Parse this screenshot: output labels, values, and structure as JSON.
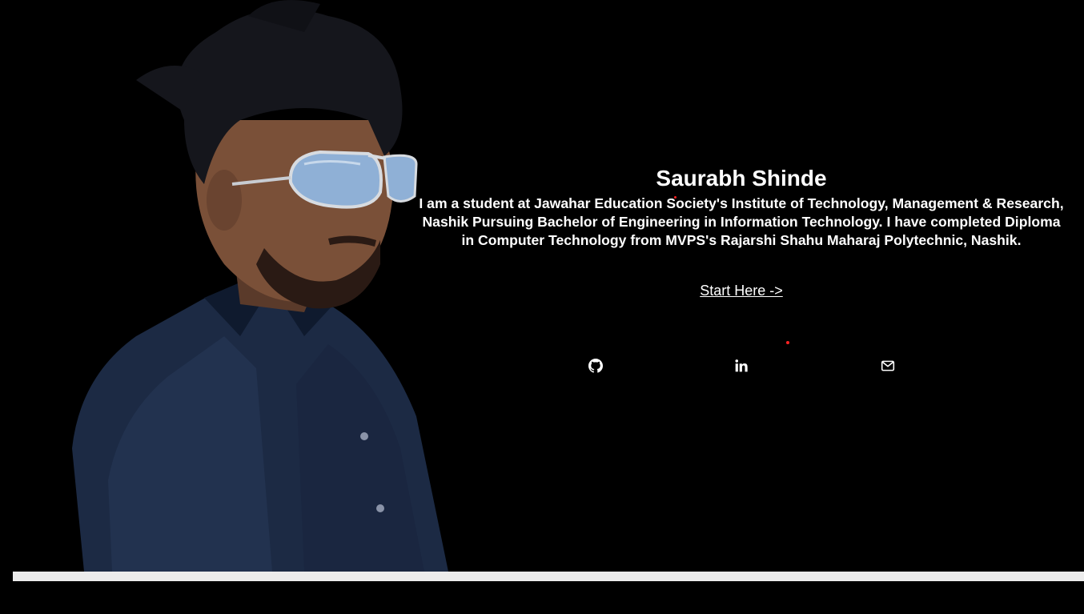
{
  "hero": {
    "name": "Saurabh Shinde",
    "bio": "I am a student at Jawahar Education Society's Institute of Technology, Management & Research, Nashik Pursuing Bachelor of Engineering in Information Technology. I have completed Diploma in Computer Technology from MVPS's Rajarshi Shahu Maharaj Polytechnic, Nashik.",
    "cta_label": "Start Here ->"
  },
  "portrait": {
    "icon": "profile-photo"
  },
  "social": {
    "items": [
      {
        "icon": "github-icon"
      },
      {
        "icon": "linkedin-icon"
      },
      {
        "icon": "mail-icon"
      }
    ]
  },
  "colors": {
    "background": "#000000",
    "text": "#ffffff",
    "accent_dot": "#ff2222",
    "footer_bar": "#ececec"
  }
}
